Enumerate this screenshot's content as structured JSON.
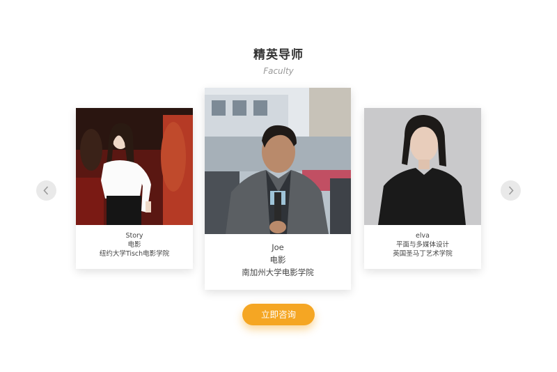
{
  "section": {
    "title": "精英导师",
    "subtitle": "Faculty"
  },
  "carousel": {
    "prev_icon": "chevron-left-icon",
    "next_icon": "chevron-right-icon",
    "cards": [
      {
        "name": "Story",
        "major": "电影",
        "school": "纽约大学Tisch电影学院"
      },
      {
        "name": "Joe",
        "major": "电影",
        "school": "南加州大学电影学院"
      },
      {
        "name": "elva",
        "major": "平面与多媒体设计",
        "school": "英国圣马丁艺术学院"
      }
    ]
  },
  "cta": {
    "label": "立即咨询"
  },
  "colors": {
    "accent": "#f5a623",
    "arrow_bg": "#e9e9e9"
  }
}
